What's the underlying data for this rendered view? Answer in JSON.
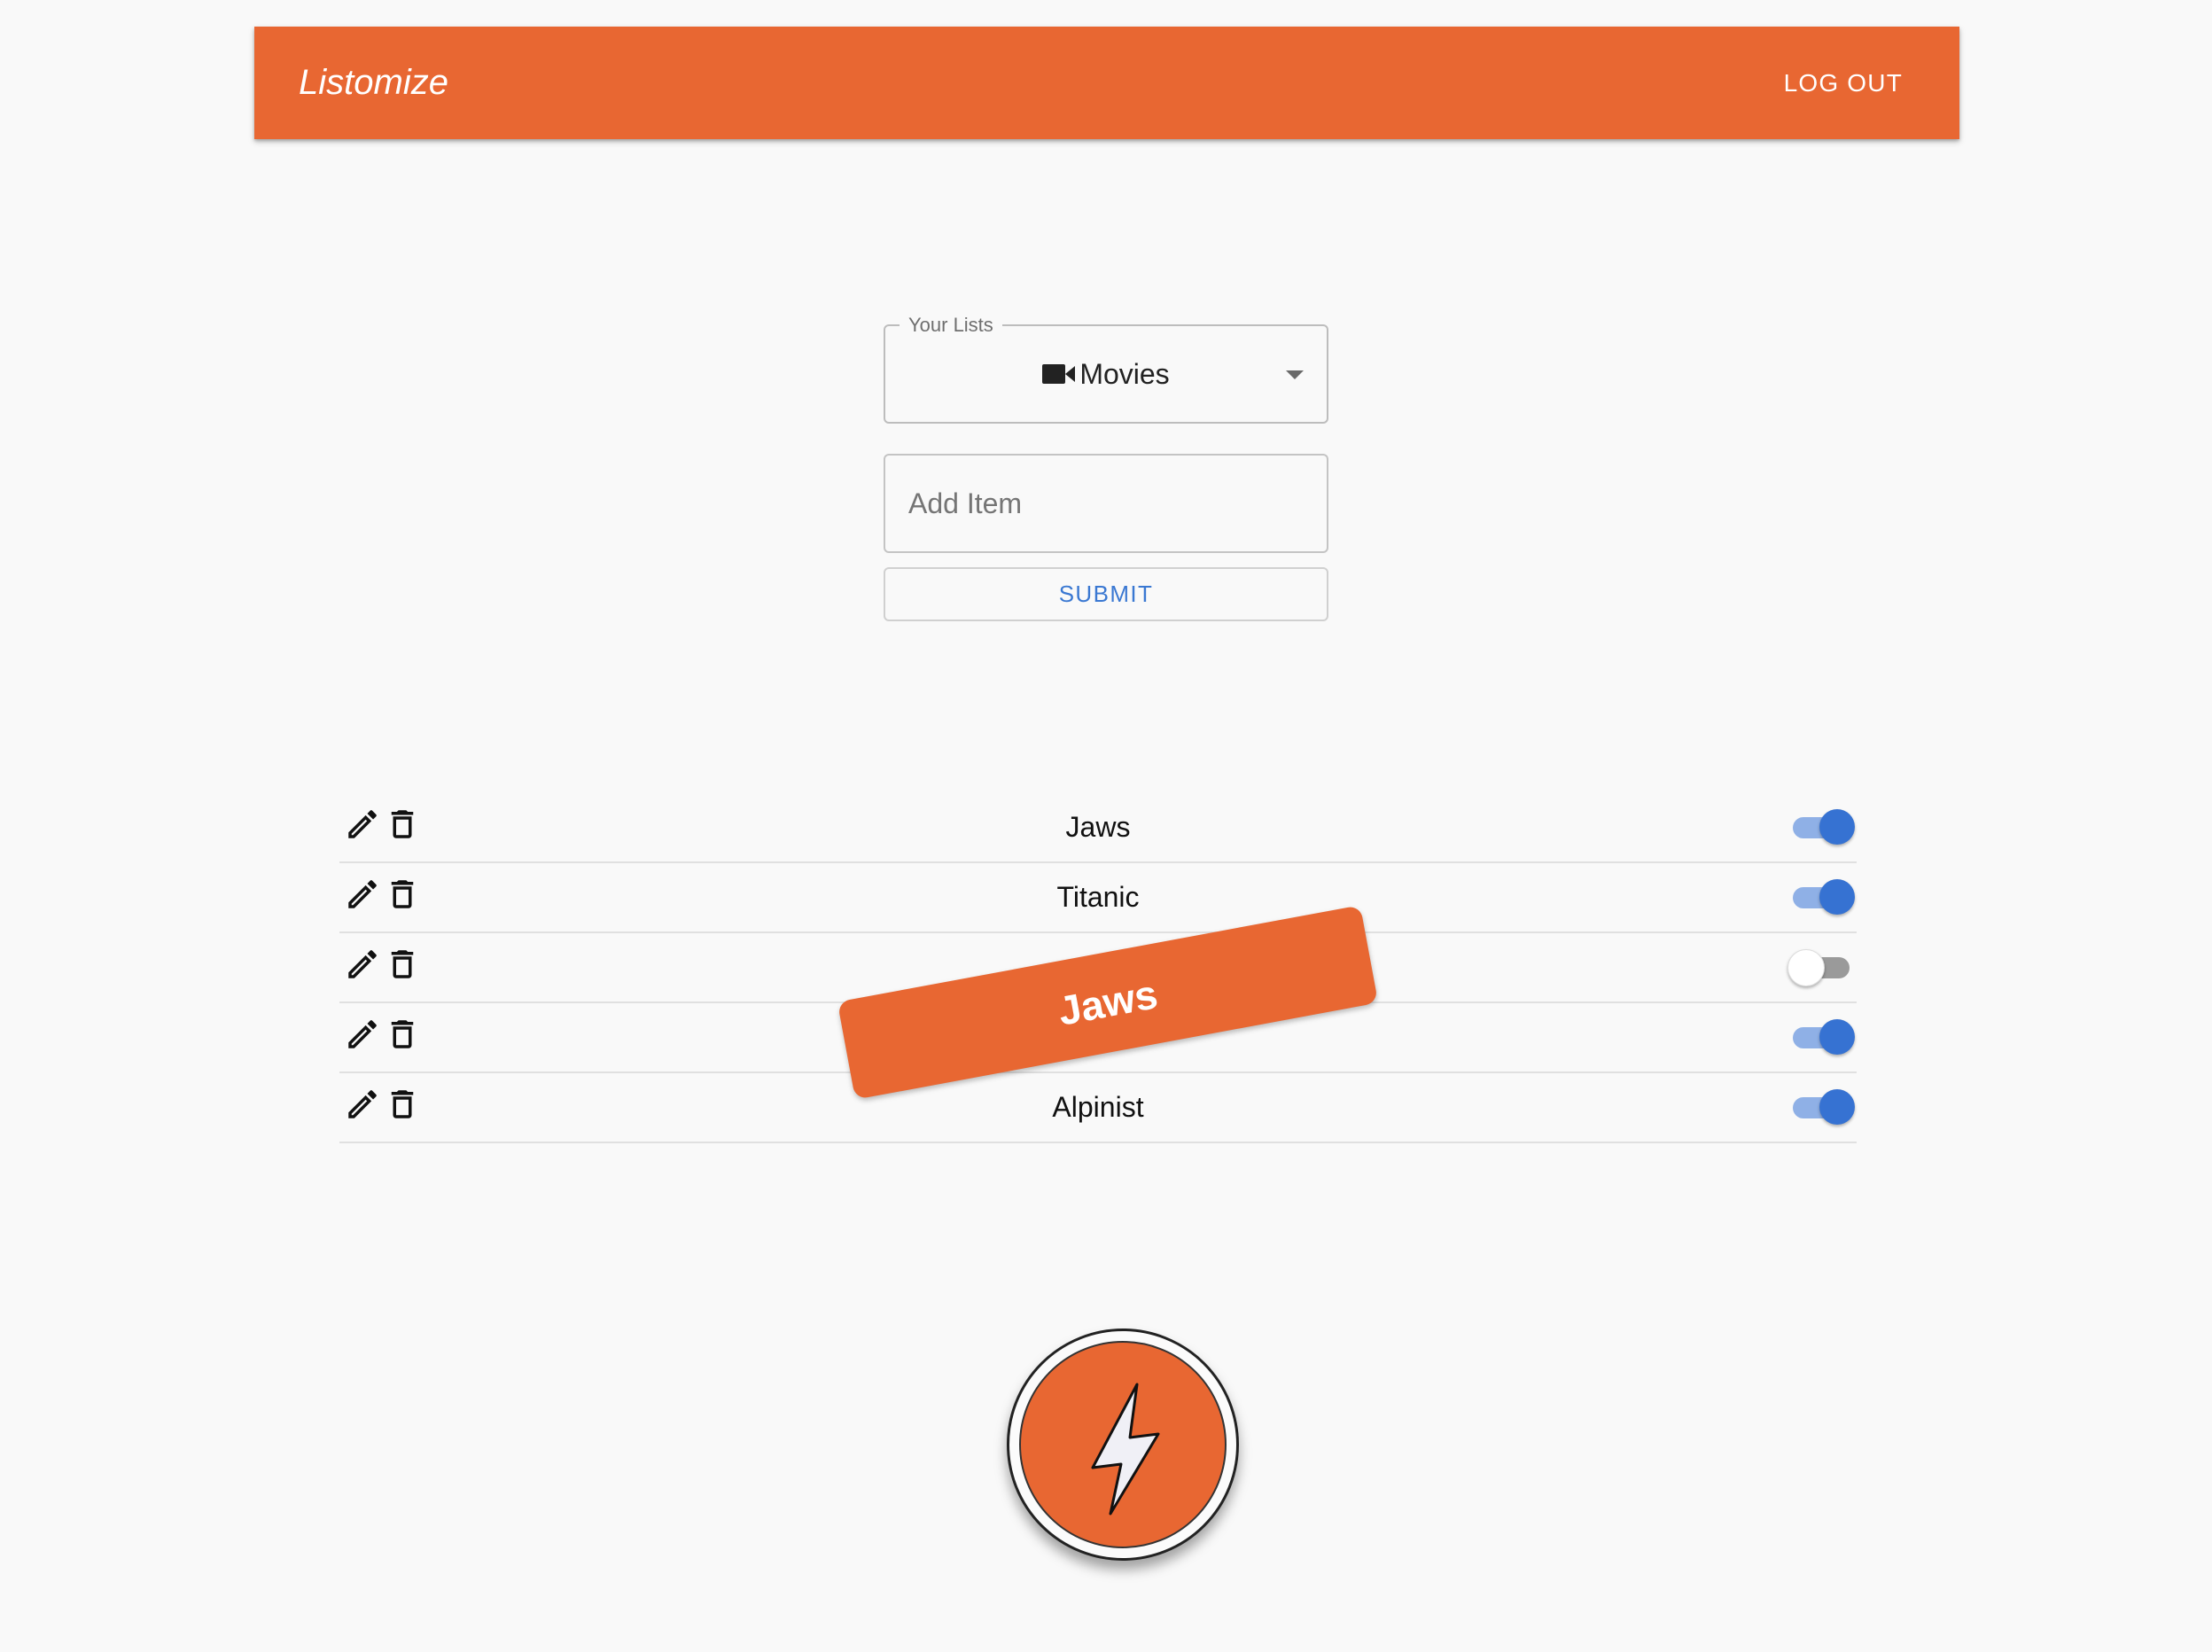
{
  "app": {
    "brand": "Listomize",
    "logout_label": "LOG OUT",
    "accent_color": "#e86732"
  },
  "list_select": {
    "label": "Your Lists",
    "selected": "Movies",
    "selected_icon": "video-camera-icon"
  },
  "add_item": {
    "placeholder": "Add Item",
    "value": ""
  },
  "submit_label": "SUBMIT",
  "items": [
    {
      "label": "Jaws",
      "enabled": true
    },
    {
      "label": "Titanic",
      "enabled": true
    },
    {
      "label": "",
      "enabled": false
    },
    {
      "label": "",
      "enabled": true
    },
    {
      "label": "Alpinist",
      "enabled": true
    }
  ],
  "drag_overlay": {
    "label": "Jaws"
  },
  "fab": {
    "icon": "lightning-bolt-icon"
  }
}
